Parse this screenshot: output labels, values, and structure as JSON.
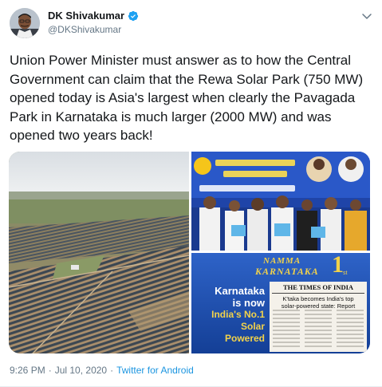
{
  "author": {
    "name": "DK Shivakumar",
    "handle": "@DKShivakumar",
    "verified": true,
    "avatar_icon": "profile-photo-icon"
  },
  "tweet": {
    "text": "Union Power Minister must answer as to how the Central Government can claim that the Rewa Solar Park (750 MW) opened today is Asia's largest when clearly the Pavagada Park in Karnataka is much larger (2000 MW) and was opened two years back!",
    "time": "9:26 PM",
    "separator": "·",
    "date": "Jul 10, 2020",
    "source": "Twitter for Android"
  },
  "media": {
    "photo_right_bottom": {
      "brand": "NAMMA",
      "brand2": "KARNATAKA",
      "brand_num": "1",
      "brand_sub": "st",
      "headline1": "Karnataka",
      "headline2": "is now",
      "headline3": "India's No.1",
      "headline4": "Solar",
      "headline5": "Powered",
      "paper": "THE TIMES OF INDIA",
      "paper_headline1": "K'taka becomes India's top",
      "paper_headline2": "solar-powered state: Report"
    }
  },
  "colors": {
    "accent": "#1da1f2",
    "link": "#1b95e0",
    "muted": "#657786",
    "text": "#14171a"
  }
}
